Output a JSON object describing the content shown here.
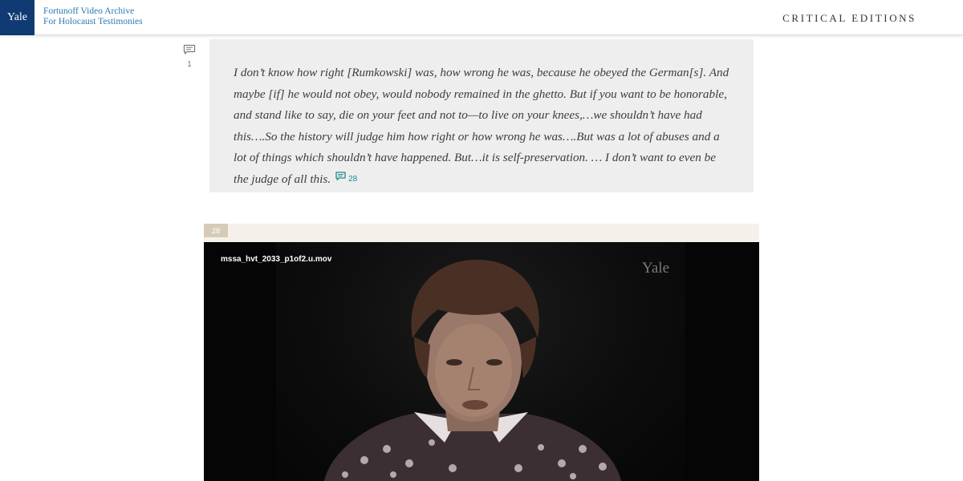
{
  "header": {
    "logo_text": "Yale",
    "archive_line1": "Fortunoff Video Archive",
    "archive_line2": "For Holocaust Testimonies",
    "nav_label": "CRITICAL EDITIONS",
    "brand_color": "#0f3a72",
    "link_color": "#2a7ab6"
  },
  "comment_marker": {
    "icon": "comment-icon",
    "count": "1"
  },
  "quote": {
    "text": "I don’t know how right [Rumkowski] was, how wrong he was, because he obeyed the German[s]. And maybe [if] he would not obey, would nobody remained in the ghetto. But if you want to be honorable, and stand like to say, die on your feet and not to—to live on your knees,…we shouldn’t have had this….So the history will judge him how right or how wrong he was….But was a lot of abuses and a lot of things which shouldn’t have happened. But…it is self-preservation. … I don’t want to even be the judge of all this.",
    "note_icon": "comment-icon",
    "note_ref": "28",
    "note_color": "#1e8a8a"
  },
  "clip": {
    "badge": "28",
    "filename": "mssa_hvt_2033_p1of2.u.mov",
    "watermark": "Yale"
  }
}
